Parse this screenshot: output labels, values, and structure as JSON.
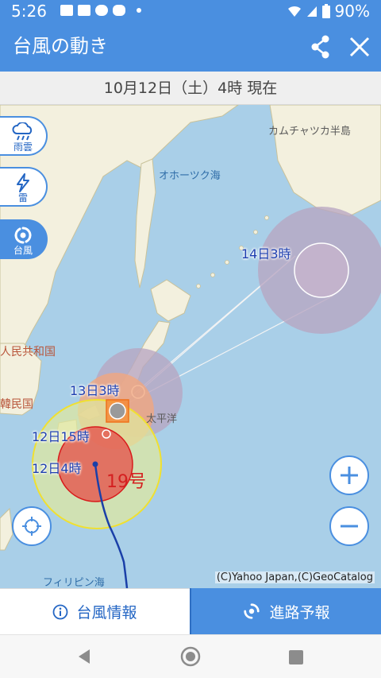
{
  "status_bar": {
    "time": "5:26",
    "battery_percent": "90%",
    "icons": [
      "image-icon",
      "email-icon",
      "cloud-icon",
      "chat-icon",
      "dot-icon",
      "wifi-icon",
      "signal-icon",
      "battery-icon"
    ]
  },
  "app_bar": {
    "title": "台風の動き",
    "share_icon": "share-icon",
    "close_icon": "close-icon",
    "accent_color": "#4a8fe0"
  },
  "date_bar": {
    "text": "10月12日（土）4時 現在"
  },
  "layers": [
    {
      "label": "雨雲",
      "icon": "rain-cloud-icon",
      "active": false
    },
    {
      "label": "雷",
      "icon": "lightning-icon",
      "active": false
    },
    {
      "label": "台風",
      "icon": "typhoon-icon",
      "active": true
    }
  ],
  "map": {
    "labels": {
      "kamchatka": "カムチャツカ半島",
      "okhotsk": "オホーツク海",
      "china": "人民共和国",
      "korea": "韓民国",
      "pacific": "太平洋",
      "philippine_sea": "フィリピン海"
    },
    "track": {
      "points": [
        "12日4時",
        "12日15時",
        "13日3時",
        "14日3時"
      ],
      "typhoon_number": "19号"
    },
    "copyright": "(C)Yahoo Japan,(C)GeoCatalog",
    "colors": {
      "storm_zone": "#e03030",
      "gale_zone": "#f4e23a",
      "forecast_circle": "#b89ab8"
    }
  },
  "map_controls": {
    "locate_icon": "crosshair-icon",
    "zoom_in_icon": "plus-icon",
    "zoom_out_icon": "minus-icon"
  },
  "tabs": [
    {
      "label": "台風情報",
      "icon": "info-icon",
      "active": false
    },
    {
      "label": "進路予報",
      "icon": "typhoon-icon",
      "active": true
    }
  ],
  "nav_bar": {
    "icons": [
      "back-icon",
      "home-icon",
      "recents-icon"
    ]
  }
}
